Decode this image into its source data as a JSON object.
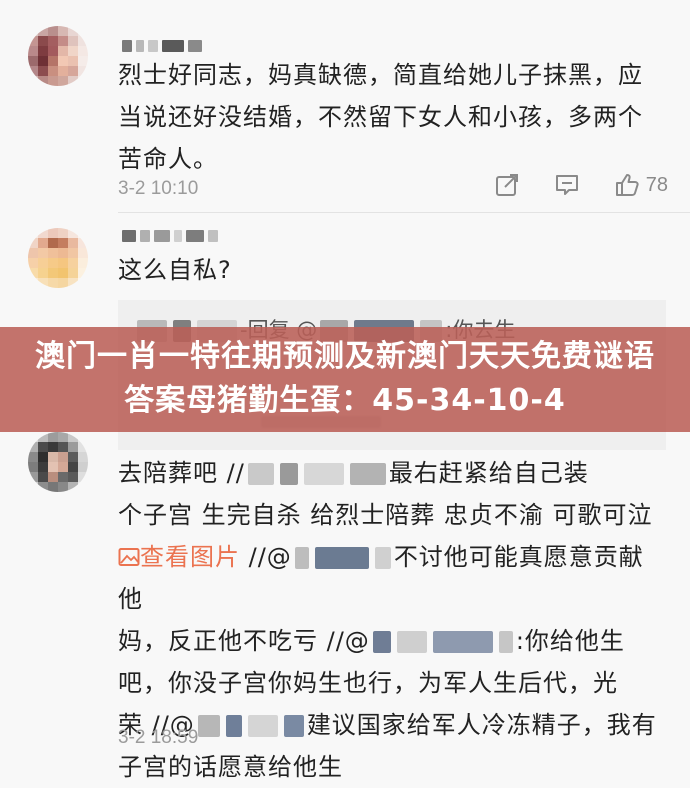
{
  "banner": {
    "text": "澳门一肖一特往期预测及新澳门天天免费谜语答案母猪勤生蛋：45-34-10-4"
  },
  "comments": [
    {
      "text": "烈士好同志，妈真缺德，简直给她儿子抹黑，应当说还好没结婚，不然留下女人和小孩，多两个苦命人。",
      "time": "3-2 10:10",
      "like_count": "78"
    },
    {
      "text": "这么自私?",
      "reply": {
        "prefix": "-回复 @",
        "suffix": ":你去生"
      }
    },
    {
      "line1_a": "去陪葬吧 //",
      "line1_b": "最右赶紧给自己装",
      "line2": "个子宫 生完自杀 给烈士陪葬 忠贞不渝 可歌可泣",
      "pic_link": "查看图片",
      "line3_a": " //@",
      "line3_b": "不讨他可能真愿意贡献他",
      "line4_a": "妈，反正他不吃亏 //@",
      "line4_b": ":你给他生",
      "line5": "吧，你没子宫你妈生也行，为军人生后代，光",
      "line6_a": "荣 //@",
      "line6_b": "建议国家给军人冷冻精子，我有",
      "line7": "子宫的话愿意给他生",
      "time": "3-2 18:59"
    }
  ],
  "colors": {
    "banner": "#bb6058",
    "link": "#eb7350",
    "time": "#9b9b9b"
  },
  "icons": [
    "share-icon",
    "comment-icon",
    "like-icon",
    "picture-icon"
  ]
}
